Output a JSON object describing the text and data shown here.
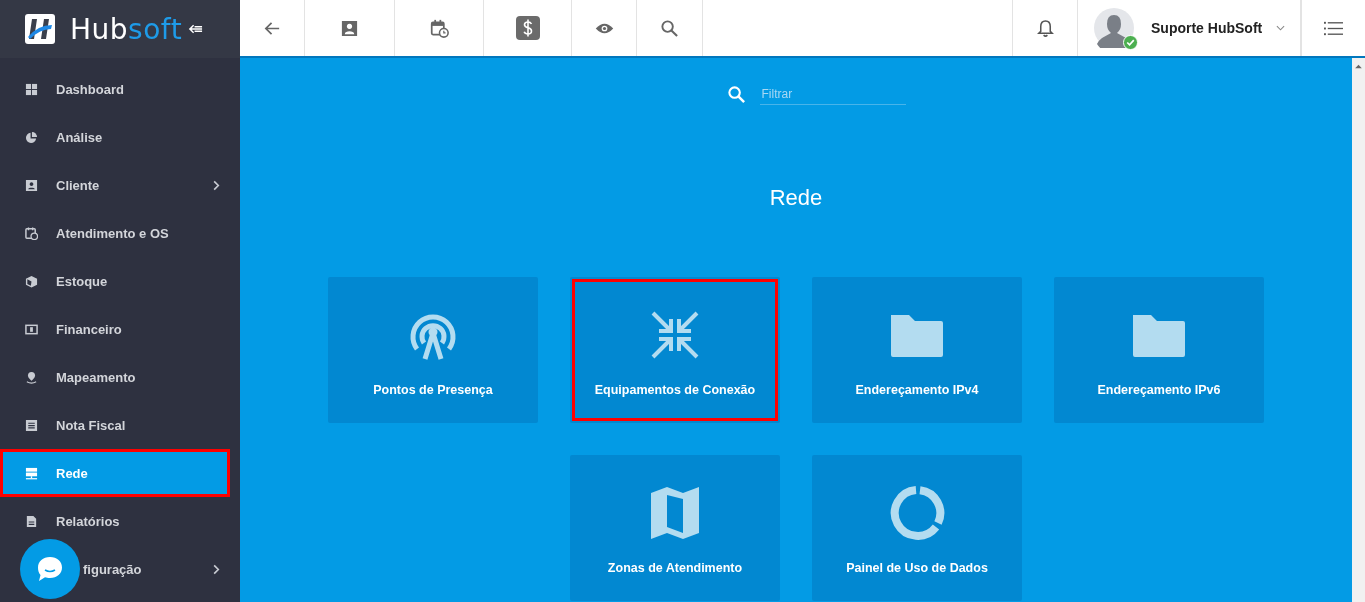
{
  "logo": {
    "part_1": "Hub",
    "part_2": "soft"
  },
  "user": {
    "name": "Suporte HubSoft",
    "online": true
  },
  "sidebar": {
    "items": [
      {
        "label": "Dashboard",
        "kind": "grid",
        "selected": false,
        "has_submenu": false,
        "highlighted": false
      },
      {
        "label": "Análise",
        "kind": "pie",
        "selected": false,
        "has_submenu": false,
        "highlighted": false
      },
      {
        "label": "Cliente",
        "kind": "contact",
        "selected": false,
        "has_submenu": true,
        "highlighted": false
      },
      {
        "label": "Atendimento e OS",
        "kind": "calendar",
        "selected": false,
        "has_submenu": false,
        "highlighted": false
      },
      {
        "label": "Estoque",
        "kind": "box",
        "selected": false,
        "has_submenu": false,
        "highlighted": false
      },
      {
        "label": "Financeiro",
        "kind": "money",
        "selected": false,
        "has_submenu": false,
        "highlighted": false
      },
      {
        "label": "Mapeamento",
        "kind": "pin",
        "selected": false,
        "has_submenu": false,
        "highlighted": false
      },
      {
        "label": "Nota Fiscal",
        "kind": "doc",
        "selected": false,
        "has_submenu": false,
        "highlighted": false
      },
      {
        "label": "Rede",
        "kind": "server",
        "selected": true,
        "has_submenu": false,
        "highlighted": true
      },
      {
        "label": "Relatórios",
        "kind": "file",
        "selected": false,
        "has_submenu": false,
        "highlighted": false
      },
      {
        "label": "figuração",
        "kind": "covered",
        "selected": false,
        "has_submenu": true,
        "highlighted": false
      }
    ]
  },
  "filter": {
    "placeholder": "Filtrar"
  },
  "page_title": "Rede",
  "tiles": [
    {
      "label": "Pontos de Presença",
      "kind": "antenna",
      "highlighted": false
    },
    {
      "label": "Equipamentos de Conexão",
      "kind": "compress",
      "highlighted": true
    },
    {
      "label": "Endereçamento IPv4",
      "kind": "folder",
      "highlighted": false
    },
    {
      "label": "Endereçamento IPv6",
      "kind": "folder",
      "highlighted": false
    },
    {
      "label": "Zonas de Atendimento",
      "kind": "map",
      "highlighted": false
    },
    {
      "label": "Painel de Uso de Dados",
      "kind": "ring",
      "highlighted": false
    }
  ]
}
